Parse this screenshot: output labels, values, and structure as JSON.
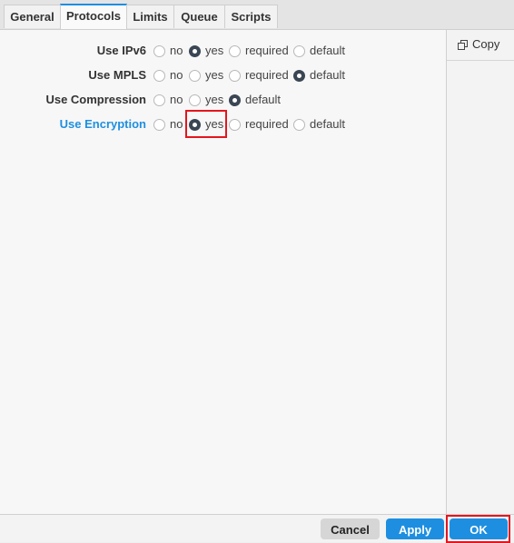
{
  "tabs": [
    {
      "label": "General",
      "active": false
    },
    {
      "label": "Protocols",
      "active": true
    },
    {
      "label": "Limits",
      "active": false
    },
    {
      "label": "Queue",
      "active": false
    },
    {
      "label": "Scripts",
      "active": false
    }
  ],
  "side": {
    "copy_label": "Copy",
    "copy_icon": "copy-icon"
  },
  "rows": [
    {
      "label": "Use IPv6",
      "options": [
        "no",
        "yes",
        "required",
        "default"
      ],
      "selected": "yes"
    },
    {
      "label": "Use MPLS",
      "options": [
        "no",
        "yes",
        "required",
        "default"
      ],
      "selected": "default"
    },
    {
      "label": "Use Compression",
      "options": [
        "no",
        "yes",
        "default"
      ],
      "selected": "default"
    },
    {
      "label": "Use Encryption",
      "options": [
        "no",
        "yes",
        "required",
        "default"
      ],
      "selected": "yes"
    }
  ],
  "footer": {
    "cancel_label": "Cancel",
    "apply_label": "Apply",
    "ok_label": "OK"
  },
  "colors": {
    "accent": "#1e8fe0",
    "highlight_box": "#e3161e"
  }
}
